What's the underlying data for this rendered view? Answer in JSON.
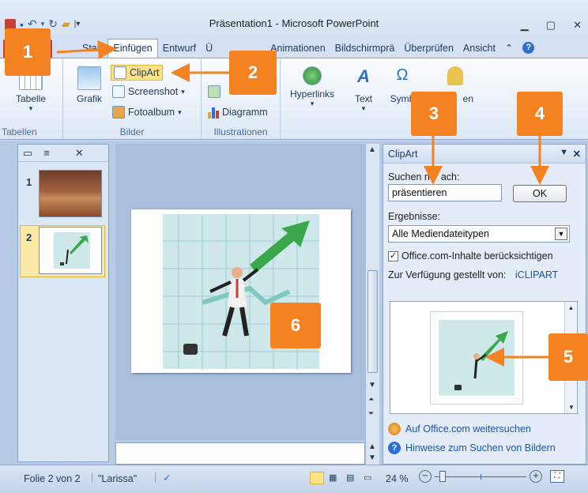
{
  "window": {
    "title": "Präsentation1  -  Microsoft PowerPoint"
  },
  "tabs": [
    "Start",
    "Einfügen",
    "Entwurf",
    "Ü",
    "Animationen",
    "Bildschirmprä",
    "Überprüfen",
    "Ansicht"
  ],
  "ribbon": {
    "tabelle": "Tabelle",
    "tabellen_group": "Tabellen",
    "grafik": "Grafik",
    "clipart": "ClipArt",
    "screenshot": "Screenshot",
    "fotoalbum": "Fotoalbum",
    "bilder_group": "Bilder",
    "s_partial": "S",
    "diagramm": "Diagramm",
    "illustrationen_group": "Illustrationen",
    "hyperlinks": "Hyperlinks",
    "text": "Text",
    "symbole_partial": "Symb",
    "medien_partial": "en"
  },
  "slides_pane": {
    "slide1_num": "1",
    "slide2_num": "2"
  },
  "taskpane": {
    "title": "ClipArt",
    "search_label_a": "Suchen n",
    "search_label_b": "ach:",
    "search_value": "präsentieren",
    "ok_label": "OK",
    "results_label": "Ergebnisse:",
    "media_type": "Alle Mediendateitypen",
    "include_office": "Office.com-Inhalte berücksichtigen",
    "include_office_checked": true,
    "provided_by": "Zur Verfügung gestellt von:",
    "provider": "iCLIPART",
    "search_online": "Auf Office.com weitersuchen",
    "hints": "Hinweise zum Suchen von Bildern"
  },
  "statusbar": {
    "slide_info": "Folie 2 von 2",
    "theme": "\"Larissa\"",
    "zoom": "24 %"
  },
  "callouts": [
    "1",
    "2",
    "3",
    "4",
    "5",
    "6"
  ],
  "colors": {
    "callout": "#f58220",
    "file_tab": "#c14238",
    "highlight": "#fce38a"
  }
}
